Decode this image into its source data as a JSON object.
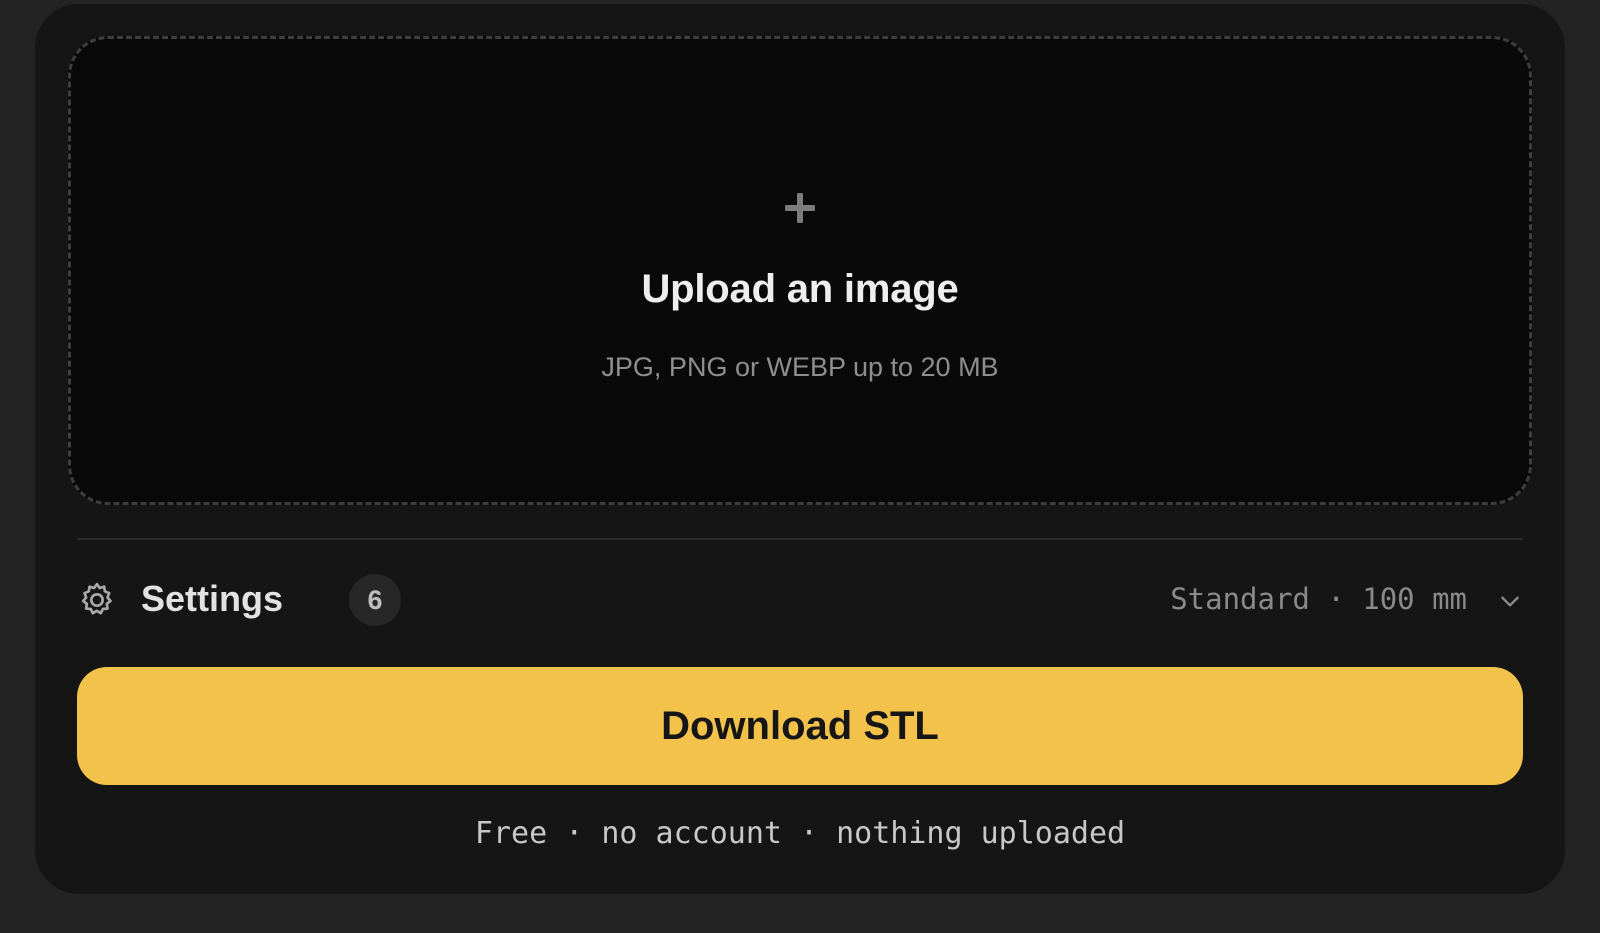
{
  "dropzone": {
    "icon": "plus-icon",
    "title": "Upload an image",
    "subtitle": "JPG, PNG or WEBP up to 20 MB"
  },
  "settings": {
    "icon": "gear-icon",
    "label": "Settings",
    "count": "6",
    "summary": "Standard · 100 mm",
    "expand_icon": "chevron-down-icon"
  },
  "download": {
    "label": "Download STL",
    "color": "#f3c24a"
  },
  "footnote": "Free · no account · nothing uploaded"
}
